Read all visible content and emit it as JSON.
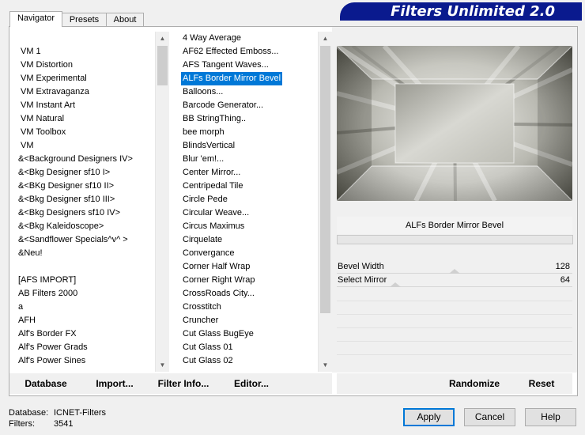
{
  "tabs": [
    "Navigator",
    "Presets",
    "About"
  ],
  "banner": "Filters Unlimited 2.0",
  "categories": [
    "VM 1",
    "VM Distortion",
    "VM Experimental",
    "VM Extravaganza",
    "VM Instant Art",
    "VM Natural",
    "VM Toolbox",
    "VM",
    "&<Background Designers IV>",
    "&<Bkg Designer sf10 I>",
    "&<BKg Designer sf10 II>",
    "&<Bkg Designer sf10 III>",
    "&<Bkg Designers sf10 IV>",
    "&<Bkg Kaleidoscope>",
    "&<Sandflower Specials^v^ >",
    "&Neu!",
    "",
    "[AFS IMPORT]",
    "AB Filters 2000",
    "a",
    "AFH",
    "Alf's Border FX",
    "Alf's Power Grads",
    "Alf's Power Sines"
  ],
  "filters": [
    "4 Way Average",
    "AF62 Effected Emboss...",
    "AFS Tangent Waves...",
    "ALFs Border Mirror Bevel",
    "Balloons...",
    "Barcode Generator...",
    "BB StringThing..",
    "bee morph",
    "BlindsVertical",
    "Blur 'em!...",
    "Center Mirror...",
    "Centripedal Tile",
    "Circle Pede",
    "Circular Weave...",
    "Circus Maximus",
    "Cirquelate",
    "Convergance",
    "Corner Half Wrap",
    "Corner Right Wrap",
    "CrossRoads City...",
    "Crosstitch",
    "Cruncher",
    "Cut Glass  BugEye",
    "Cut Glass 01",
    "Cut Glass 02"
  ],
  "selected_filter_index": 3,
  "filter_name": "ALFs Border Mirror Bevel",
  "params": [
    {
      "label": "Bevel Width",
      "value": "128",
      "level": 0.5
    },
    {
      "label": "Select Mirror",
      "value": "64",
      "level": 0.25
    }
  ],
  "toolbar": {
    "database": "Database",
    "import": "Import...",
    "filter_info": "Filter Info...",
    "editor": "Editor...",
    "randomize": "Randomize",
    "reset": "Reset"
  },
  "info": {
    "database_label": "Database:",
    "database_value": "ICNET-Filters",
    "filters_label": "Filters:",
    "filters_value": "3541"
  },
  "buttons": {
    "apply": "Apply",
    "cancel": "Cancel",
    "help": "Help"
  }
}
